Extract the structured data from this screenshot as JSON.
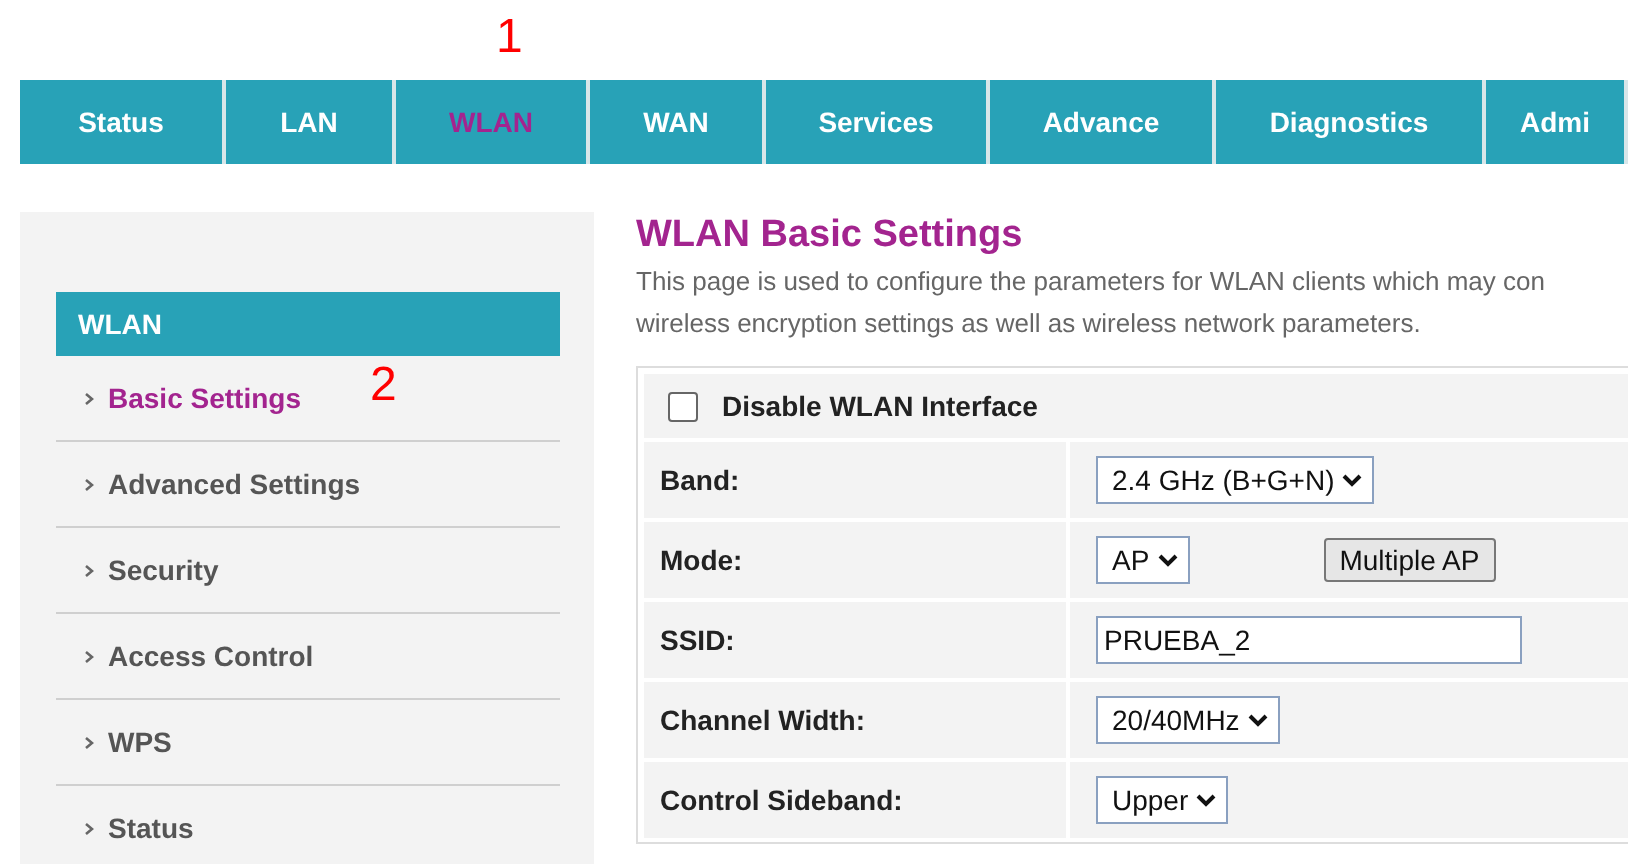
{
  "annotations": [
    {
      "text": "1",
      "color": "#ff0000"
    },
    {
      "text": "2",
      "color": "#ff0000"
    }
  ],
  "nav": [
    {
      "label": "Status",
      "selected": false
    },
    {
      "label": "LAN",
      "selected": false
    },
    {
      "label": "WLAN",
      "selected": true
    },
    {
      "label": "WAN",
      "selected": false
    },
    {
      "label": "Services",
      "selected": false
    },
    {
      "label": "Advance",
      "selected": false
    },
    {
      "label": "Diagnostics",
      "selected": false
    },
    {
      "label": "Admi",
      "selected": false
    }
  ],
  "sidebar": {
    "title": "WLAN",
    "items": [
      {
        "label": "Basic Settings",
        "selected": true
      },
      {
        "label": "Advanced Settings",
        "selected": false
      },
      {
        "label": "Security",
        "selected": false
      },
      {
        "label": "Access Control",
        "selected": false
      },
      {
        "label": "WPS",
        "selected": false
      },
      {
        "label": "Status",
        "selected": false
      }
    ]
  },
  "content": {
    "title": "WLAN Basic Settings",
    "description": [
      "This page is used to configure the parameters for WLAN clients which may con",
      "wireless encryption settings as well as wireless network parameters."
    ],
    "disable_checkbox": {
      "label": "Disable WLAN Interface",
      "checked": false
    },
    "rows": [
      {
        "label": "Band:",
        "kind": "select",
        "value": "2.4 GHz (B+G+N)"
      },
      {
        "label": "Mode:",
        "kind": "select",
        "value": "AP",
        "button": "Multiple AP"
      },
      {
        "label": "SSID:",
        "kind": "text",
        "value": "PRUEBA_2"
      },
      {
        "label": "Channel Width:",
        "kind": "select",
        "value": "20/40MHz"
      },
      {
        "label": "Control Sideband:",
        "kind": "select",
        "value": "Upper"
      }
    ]
  }
}
